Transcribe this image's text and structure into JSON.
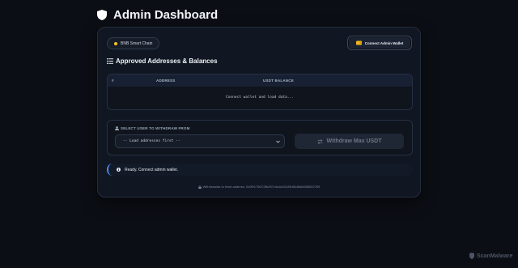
{
  "header": {
    "title": "Admin Dashboard"
  },
  "card": {
    "chain_badge": "BNB Smart Chain",
    "connect_button": "Connect Admin Wallet",
    "section_title": "Approved Addresses & Balances",
    "table": {
      "columns": [
        "#",
        "ADDRESS",
        "USDT BALANCE"
      ],
      "empty_message": "Connect wallet and load data..."
    },
    "withdraw": {
      "label": "SELECT USER TO WITHDRAW FROM",
      "select_value": "-- Load addresses first --",
      "button": "Withdraw Max USDT"
    },
    "status": "Ready. Connect admin wallet.",
    "footer": "Withdrawals to fixed address: 0x0f91750C2Bcf57c4a4c0318f185d6fd4858502789"
  },
  "watermark": "ScanMalware",
  "colors": {
    "background": "#0b0e14",
    "card": "#111722",
    "accent": "#4c86f0",
    "badge_dot": "#f3c623"
  }
}
